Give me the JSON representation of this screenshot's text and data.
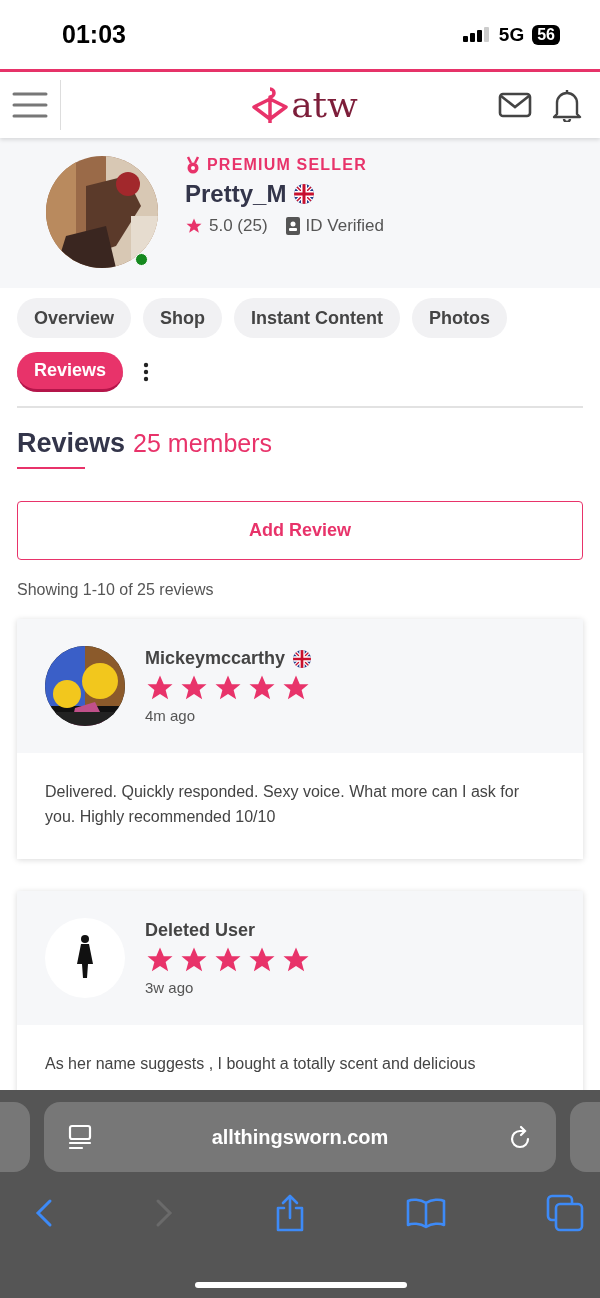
{
  "status_bar": {
    "time": "01:03",
    "network": "5G",
    "battery": "56"
  },
  "header": {
    "logo": "atw"
  },
  "profile": {
    "badge": "PREMIUM SELLER",
    "name": "Pretty_M",
    "rating": "5.0 (25)",
    "verified": "ID Verified",
    "online": true
  },
  "tabs": [
    {
      "label": "Overview",
      "selected": false
    },
    {
      "label": "Shop",
      "selected": false
    },
    {
      "label": "Instant Content",
      "selected": false
    },
    {
      "label": "Photos",
      "selected": false
    },
    {
      "label": "Reviews",
      "selected": true
    }
  ],
  "section": {
    "title": "Reviews",
    "count": "25 members"
  },
  "add_button": "Add Review",
  "showing": "Showing 1-10 of 25 reviews",
  "reviews": [
    {
      "author": "Mickeymccarthy",
      "flag": true,
      "stars": 5,
      "time": "4m ago",
      "has_photo": true,
      "text": "Delivered. Quickly responded. Sexy voice. What more can I ask for you. Highly recommended 10/10"
    },
    {
      "author": "Deleted User",
      "flag": false,
      "stars": 5,
      "time": "3w ago",
      "has_photo": false,
      "text": "As her name suggests , I bought a totally scent and delicious"
    }
  ],
  "browser": {
    "url": "allthingsworn.com"
  }
}
